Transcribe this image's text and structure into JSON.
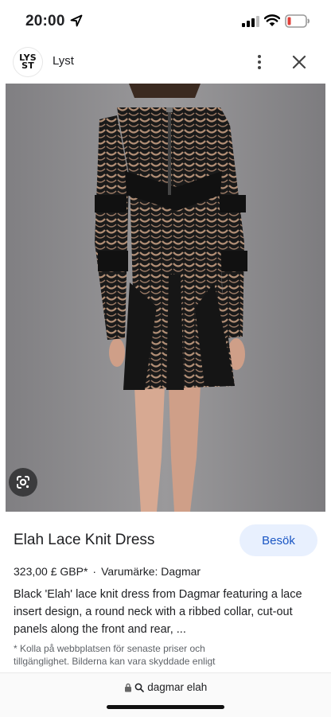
{
  "status_bar": {
    "time": "20:00",
    "icons": [
      "location-arrow-icon",
      "cellular-signal-icon",
      "wifi-icon",
      "battery-low-icon"
    ],
    "battery_color": "#e0413a"
  },
  "header": {
    "logo_text": "LYS\nST",
    "site_name": "Lyst",
    "icons": [
      "more-vertical-icon",
      "close-icon"
    ]
  },
  "image": {
    "alt": "Black lace knit dress, back view",
    "lens_icon": "google-lens-icon"
  },
  "product": {
    "title": "Elah Lace Knit Dress",
    "visit_label": "Besök",
    "price": "323,00 £ GBP*",
    "separator": "·",
    "brand": "Varumärke: Dagmar",
    "description": "Black 'Elah' lace knit dress from Dagmar featuring a lace insert design, a round neck with a ribbed collar, cut-out panels along the front and rear, ...",
    "disclaimer": "* Kolla på webbplatsen för senaste priser och tillgänglighet. Bilderna kan vara skyddade enligt"
  },
  "bottom_bar": {
    "url_text": "dagmar elah",
    "icons": [
      "lock-icon",
      "search-icon"
    ]
  },
  "colors": {
    "accent": "#1a56c4",
    "button_bg": "#e8f0fe",
    "image_bg": "#8d8c8e"
  }
}
